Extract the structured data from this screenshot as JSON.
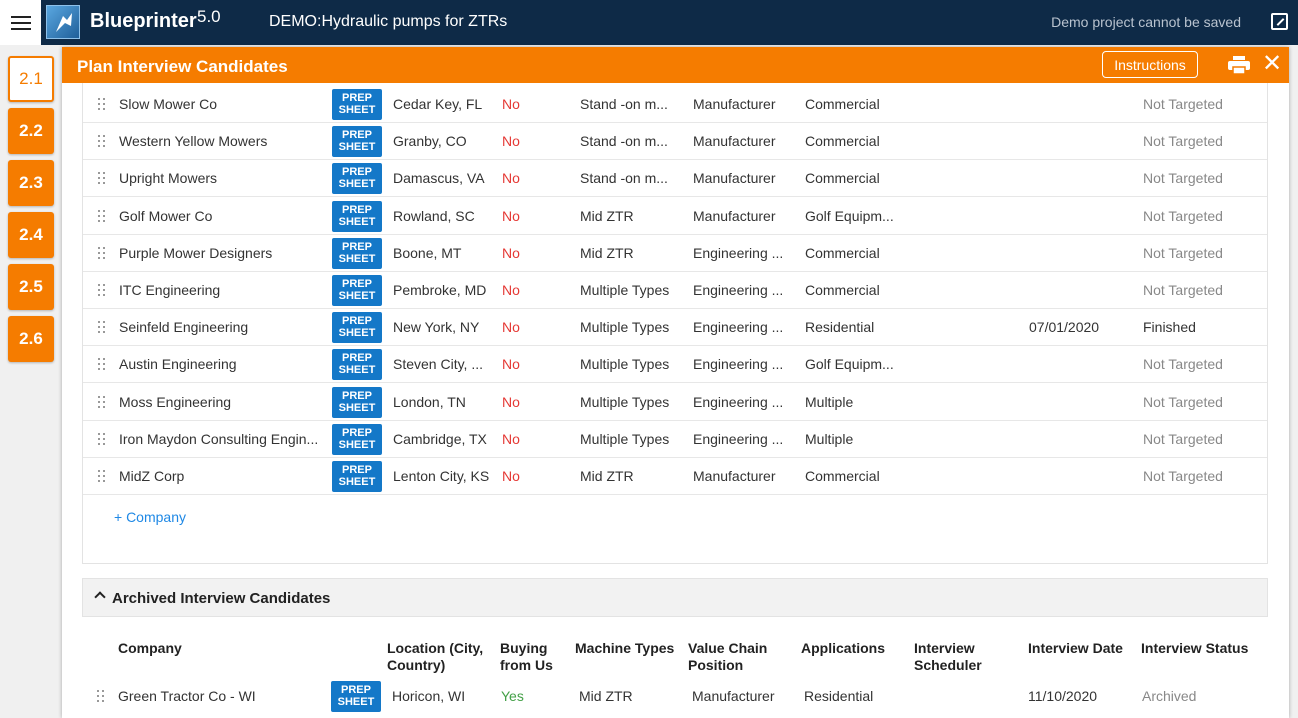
{
  "app": {
    "brand": "Blueprinter",
    "version": "5.0",
    "project_title": "DEMO:Hydraulic pumps for ZTRs",
    "demo_note": "Demo project cannot be saved"
  },
  "steps": [
    "2.1",
    "2.2",
    "2.3",
    "2.4",
    "2.5",
    "2.6"
  ],
  "panel": {
    "title": "Plan Interview Candidates",
    "instructions_label": "Instructions",
    "close_glyph": "✕"
  },
  "prep_label_1": "PREP",
  "prep_label_2": "SHEET",
  "active_rows": [
    {
      "company": "Slow Mower Co",
      "location": "Cedar Key, FL",
      "buying": "No",
      "machine": "Stand -on m...",
      "value_chain": "Manufacturer",
      "applications": "Commercial",
      "scheduler": "",
      "date": "",
      "status": "Not Targeted"
    },
    {
      "company": "Western Yellow Mowers",
      "location": "Granby, CO",
      "buying": "No",
      "machine": "Stand -on m...",
      "value_chain": "Manufacturer",
      "applications": "Commercial",
      "scheduler": "",
      "date": "",
      "status": "Not Targeted"
    },
    {
      "company": "Upright Mowers",
      "location": "Damascus, VA",
      "buying": "No",
      "machine": "Stand -on m...",
      "value_chain": "Manufacturer",
      "applications": "Commercial",
      "scheduler": "",
      "date": "",
      "status": "Not Targeted"
    },
    {
      "company": "Golf Mower Co",
      "location": "Rowland, SC",
      "buying": "No",
      "machine": "Mid ZTR",
      "value_chain": "Manufacturer",
      "applications": "Golf Equipm...",
      "scheduler": "",
      "date": "",
      "status": "Not Targeted"
    },
    {
      "company": "Purple Mower Designers",
      "location": "Boone, MT",
      "buying": "No",
      "machine": "Mid ZTR",
      "value_chain": "Engineering ...",
      "applications": "Commercial",
      "scheduler": "",
      "date": "",
      "status": "Not Targeted"
    },
    {
      "company": "ITC Engineering",
      "location": "Pembroke, MD",
      "buying": "No",
      "machine": "Multiple Types",
      "value_chain": "Engineering ...",
      "applications": "Commercial",
      "scheduler": "",
      "date": "",
      "status": "Not Targeted"
    },
    {
      "company": "Seinfeld Engineering",
      "location": "New York, NY",
      "buying": "No",
      "machine": "Multiple Types",
      "value_chain": "Engineering ...",
      "applications": "Residential",
      "scheduler": "",
      "date": "07/01/2020",
      "status": "Finished"
    },
    {
      "company": "Austin Engineering",
      "location": "Steven City, ...",
      "buying": "No",
      "machine": "Multiple Types",
      "value_chain": "Engineering ...",
      "applications": "Golf Equipm...",
      "scheduler": "",
      "date": "",
      "status": "Not Targeted"
    },
    {
      "company": "Moss Engineering",
      "location": "London, TN",
      "buying": "No",
      "machine": "Multiple Types",
      "value_chain": "Engineering ...",
      "applications": "Multiple",
      "scheduler": "",
      "date": "",
      "status": "Not Targeted"
    },
    {
      "company": "Iron Maydon Consulting Engin...",
      "location": "Cambridge, TX",
      "buying": "No",
      "machine": "Multiple Types",
      "value_chain": "Engineering ...",
      "applications": "Multiple",
      "scheduler": "",
      "date": "",
      "status": "Not Targeted"
    },
    {
      "company": "MidZ Corp",
      "location": "Lenton City, KS",
      "buying": "No",
      "machine": "Mid ZTR",
      "value_chain": "Manufacturer",
      "applications": "Commercial",
      "scheduler": "",
      "date": "",
      "status": "Not Targeted"
    }
  ],
  "add_company_label": "+ Company",
  "archived": {
    "title": "Archived Interview Candidates",
    "headers": {
      "company": "Company",
      "location_1": "Location (City,",
      "location_2": "Country)",
      "buying_1": "Buying",
      "buying_2": "from Us",
      "machine": "Machine Types",
      "value_chain_1": "Value Chain",
      "value_chain_2": "Position",
      "applications": "Applications",
      "scheduler_1": "Interview",
      "scheduler_2": "Scheduler",
      "date": "Interview Date",
      "status": "Interview Status"
    },
    "rows": [
      {
        "company": "Green Tractor Co - WI",
        "location": "Horicon, WI",
        "buying": "Yes",
        "machine": "Mid ZTR",
        "value_chain": "Manufacturer",
        "applications": "Residential",
        "scheduler": "",
        "date": "11/10/2020",
        "status": "Archived"
      }
    ]
  },
  "colors": {
    "topbar": "#0e2a47",
    "accent": "#f57c00",
    "prep_button": "#1478c8",
    "no": "#e53935",
    "yes": "#43a047"
  }
}
